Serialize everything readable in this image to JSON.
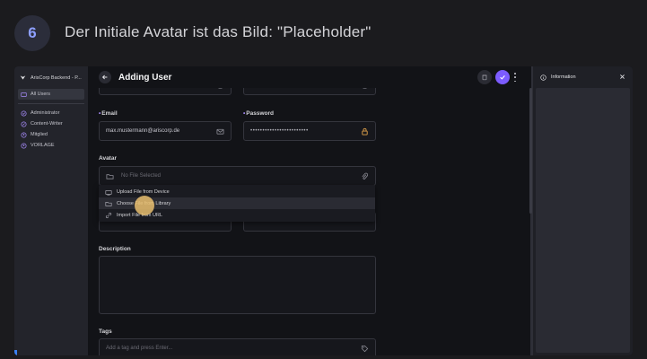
{
  "step": {
    "number": "6",
    "title": "Der Initiale Avatar ist das Bild: \"Placeholder\""
  },
  "sidebar": {
    "app_title": "ArisCorp Backend - P...",
    "items": [
      {
        "label": "All Users",
        "icon": "users-icon",
        "active": true
      },
      {
        "label": "Administrator",
        "icon": "role-icon"
      },
      {
        "label": "Content-Writer",
        "icon": "role-icon"
      },
      {
        "label": "Mitglied",
        "icon": "role-icon"
      },
      {
        "label": "VORLAGE",
        "icon": "role-icon"
      }
    ]
  },
  "header": {
    "title": "Adding User"
  },
  "form": {
    "email_label": "Email",
    "email_value": "max.mustermann@ariscorp.de",
    "password_label": "Password",
    "password_value": "••••••••••••••••••••••••",
    "avatar_label": "Avatar",
    "avatar_placeholder": "No File Selected",
    "description_label": "Description",
    "tags_label": "Tags",
    "tags_placeholder": "Add a tag and press Enter..."
  },
  "avatar_menu": [
    {
      "label": "Upload File from Device",
      "icon": "upload-icon"
    },
    {
      "label": "Choose File from Library",
      "icon": "folder-icon",
      "hovered": true
    },
    {
      "label": "Import File from URL",
      "icon": "link-icon"
    }
  ],
  "info_panel": {
    "title": "Information"
  },
  "colors": {
    "accent": "#7c5cff",
    "step_number": "#8ea0ff"
  }
}
